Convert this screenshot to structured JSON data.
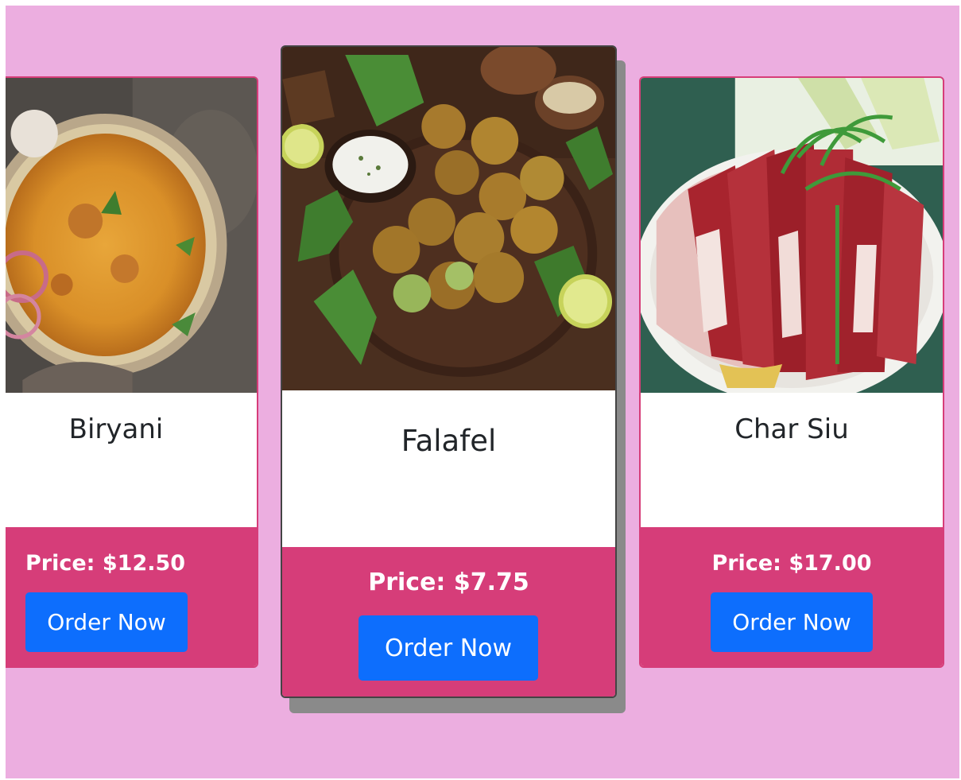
{
  "colors": {
    "page_background": "#ecaee0",
    "card_background": "#ffffff",
    "footer_background": "#d63d79",
    "button_background": "#0d6efd",
    "button_text": "#ffffff",
    "price_text": "#ffffff"
  },
  "cards": [
    {
      "image_icon": "biryani-dish-photo",
      "name": "Biryani",
      "price": "Price: $12.50",
      "button_label": "Order Now"
    },
    {
      "image_icon": "falafel-dish-photo",
      "name": "Falafel",
      "price": "Price: $7.75",
      "button_label": "Order Now"
    },
    {
      "image_icon": "char-siu-dish-photo",
      "name": "Char Siu",
      "price": "Price: $17.00",
      "button_label": "Order Now"
    }
  ]
}
